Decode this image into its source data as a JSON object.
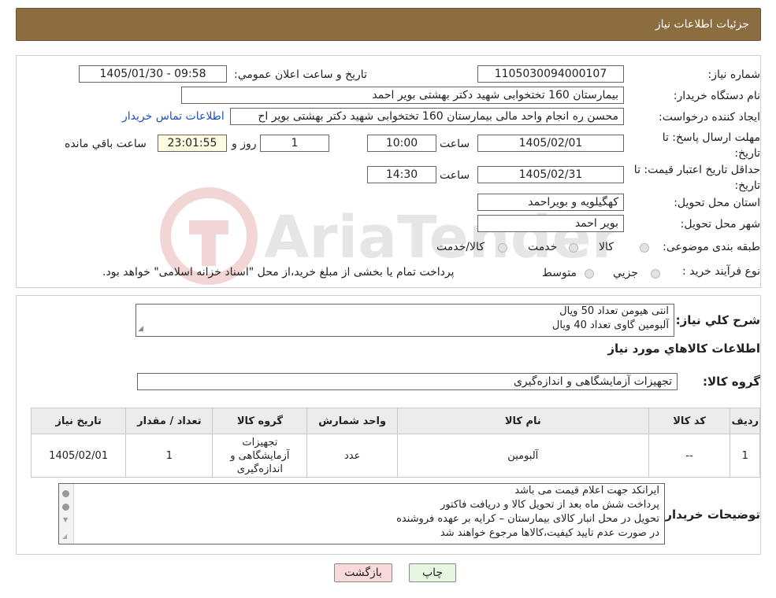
{
  "header": {
    "title": "جزئیات اطلاعات نیاز"
  },
  "form": {
    "need_number_label": "شماره نیاز:",
    "need_number": "1105030094000107",
    "announce_label": "تاریخ و ساعت اعلان عمومي:",
    "announce_value": "1405/01/30 - 09:58",
    "buyer_label": "نام دستگاه خريدار:",
    "buyer_value": "بیمارستان 160 تختخوابی شهید دکتر بهشتی بویر احمد",
    "creator_label": "ايجاد کننده درخواست:",
    "creator_value": "محسن ره انجام واحد مالی بیمارستان 160 تختخوابی شهید دکتر بهشتی بویر اح",
    "contact_link": "اطلاعات تماس خريدار",
    "deadline_label": "مهلت ارسال پاسخ: تا تاریخ:",
    "deadline_date": "1405/02/01",
    "time_label": "ساعت",
    "deadline_time": "10:00",
    "days_value": "1",
    "days_label": "روز و",
    "remaining_time": "23:01:55",
    "remaining_label": "ساعت باقي مانده",
    "validity_label": "حداقل تاريخ اعتبار قيمت: تا تاریخ:",
    "validity_date": "1405/02/31",
    "validity_time_label": "ساعت",
    "validity_time": "14:30",
    "province_label": "استان محل تحويل:",
    "province_value": "کهگیلویه و بویراحمد",
    "city_label": "شهر محل تحويل:",
    "city_value": "بویر احمد",
    "category_label": "طبقه بندی موضوعی:",
    "category_options": [
      "کالا",
      "خدمت",
      "کالا/خدمت"
    ],
    "process_label": "نوع فرآيند خريد :",
    "process_options": [
      "جزيي",
      "متوسط"
    ],
    "process_note": "پرداخت تمام يا بخشی از مبلغ خريد،از محل \"اسناد خزانه اسلامی\" خواهد بود."
  },
  "summary": {
    "label": "شرح کلي نياز:",
    "lines": [
      "انتی هیومن تعداد 50 ویال",
      "آلبومین گاوی تعداد 40 ویال"
    ]
  },
  "items_section": {
    "title": "اطلاعات کالاهاي مورد نياز",
    "group_label": "گروه کالا:",
    "group_value": "تجهيزات آزمايشگاهی و اندازه‌گيری"
  },
  "table": {
    "headers": [
      "رديف",
      "کد کالا",
      "نام کالا",
      "واحد شمارش",
      "گروه کالا",
      "تعداد / مقدار",
      "تاريخ نياز"
    ],
    "rows": [
      [
        "1",
        "--",
        "آلبومین",
        "عدد",
        "تجهيزات آزمايشگاهی و اندازه‌گيری",
        "1",
        "1405/02/01"
      ]
    ]
  },
  "notes": {
    "label": "توضيحات خريدار:",
    "lines": [
      "ایرانکد جهت اعلام قیمت می باشد",
      "پرداخت شش ماه بعد از تحویل کالا و دریافت فاکتور",
      "تحویل در محل انبار کالای بیمارستان – کرایه بر عهده فروشنده",
      "در صورت عدم تایید کیفیت،کالاها مرجوع خواهند شد"
    ]
  },
  "buttons": {
    "print": "چاپ",
    "back": "بازگشت"
  },
  "watermark": {
    "text": "AriaTender.neT"
  },
  "colors": {
    "header_bg": "#8c6d3f",
    "link": "#1a4fbf",
    "back_button_bg": "#f9d9d9",
    "print_button_bg": "#e6f6e0"
  }
}
